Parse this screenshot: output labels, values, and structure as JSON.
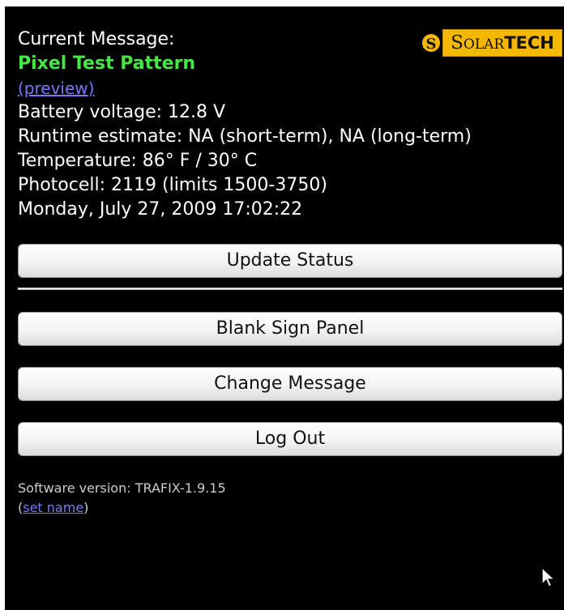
{
  "logo": {
    "brand": "SolarTech",
    "solar_initial": "S",
    "solar_rest": "OLAR",
    "tech": "TECH",
    "colors": {
      "background": "#f5b800",
      "text": "#111111"
    }
  },
  "status": {
    "current_message_label": "Current Message:",
    "current_message_value": "Pixel Test Pattern",
    "preview_link": "(preview)",
    "battery": "Battery voltage: 12.8 V",
    "runtime": "Runtime estimate: NA (short-term), NA (long-term)",
    "temperature": "Temperature: 86° F / 30° C",
    "photocell": "Photocell: 2119 (limits 1500-3750)",
    "datetime": "Monday, July 27, 2009 17:02:22"
  },
  "buttons": {
    "update_status": "Update Status",
    "blank_sign_panel": "Blank Sign Panel",
    "change_message": "Change Message",
    "log_out": "Log Out"
  },
  "footer": {
    "software_version": "Software version: TRAFIX-1.9.15",
    "open_paren": "(",
    "set_name_link": "set name",
    "close_paren": ")"
  },
  "icons": {
    "logo_mark": "sun-icon",
    "cursor": "mouse-pointer-icon"
  },
  "colors": {
    "page_background": "#000000",
    "message_name": "#44e844",
    "link": "#7878ff"
  }
}
